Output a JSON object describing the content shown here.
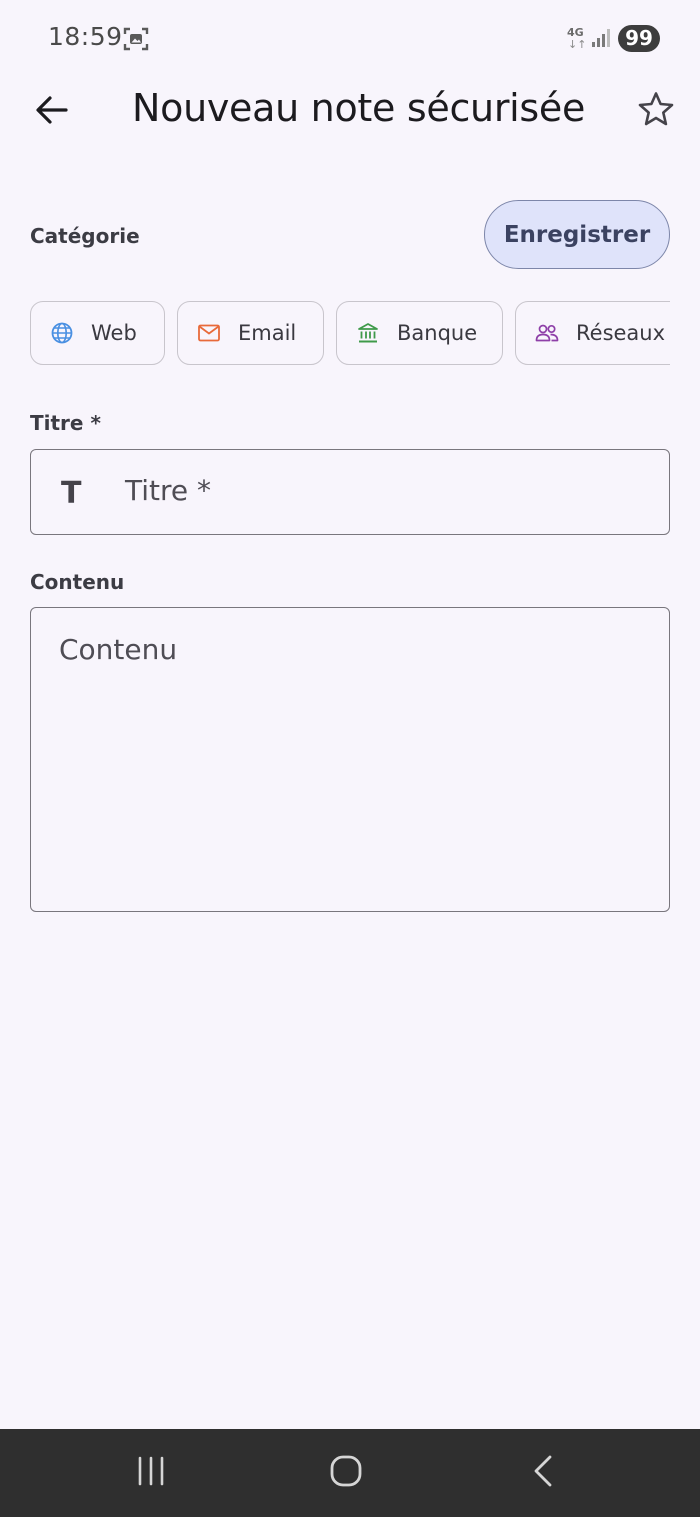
{
  "status_bar": {
    "time": "18:59",
    "network": "4G",
    "network_arrows": "↓↑",
    "battery": "99",
    "icons": [
      "screenshot-icon",
      "signal-icon"
    ]
  },
  "app_bar": {
    "title": "Nouveau note sécurisée",
    "back_icon": "arrow-back-icon",
    "favorite_icon": "star-outline-icon"
  },
  "category": {
    "label": "Catégorie",
    "save_label": "Enregistrer",
    "chips": [
      {
        "label": "Web",
        "icon": "globe-icon",
        "color": "#4a90e2"
      },
      {
        "label": "Email",
        "icon": "mail-icon",
        "color": "#e86a3a"
      },
      {
        "label": "Banque",
        "icon": "bank-icon",
        "color": "#3f9a4a"
      },
      {
        "label": "Réseaux s",
        "icon": "people-icon",
        "color": "#8e3fa8"
      }
    ]
  },
  "title_field": {
    "label": "Titre *",
    "placeholder": "Titre *",
    "icon": "text-icon",
    "icon_glyph": "T"
  },
  "content_field": {
    "label": "Contenu",
    "placeholder": "Contenu"
  },
  "colors": {
    "background": "#f8f5fc",
    "save_button_bg": "#dfe3fa",
    "nav_bar_bg": "#2f2f2f"
  },
  "nav_bar": {
    "icons": [
      "recent-apps-icon",
      "home-icon",
      "back-icon"
    ]
  }
}
